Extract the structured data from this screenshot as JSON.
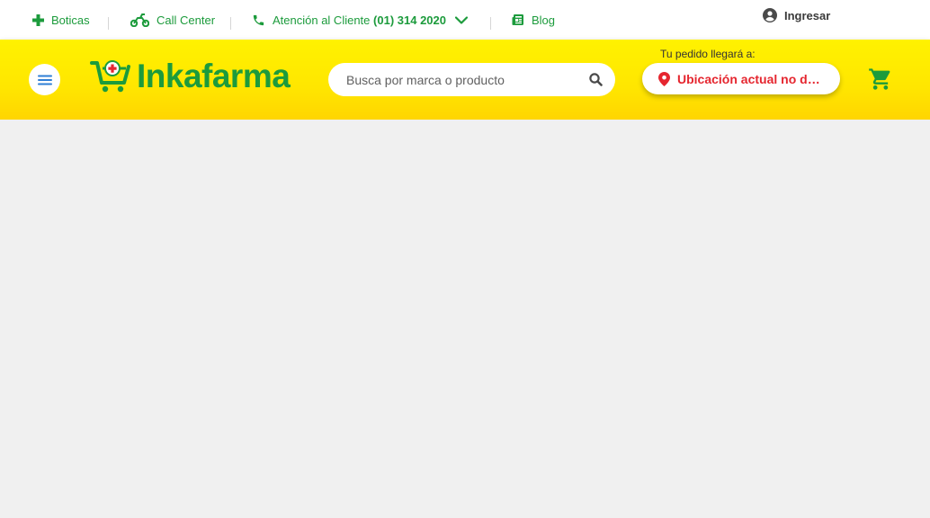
{
  "topbar": {
    "boticas": "Boticas",
    "call_center": "Call Center",
    "atencion_prefix": "Atención al Cliente",
    "atencion_phone": "(01) 314 2020",
    "blog": "Blog",
    "login": "Ingresar"
  },
  "header": {
    "logo_text": "Inkafarma",
    "search_placeholder": "Busca por marca o producto",
    "delivery_label": "Tu pedido llegará a:",
    "location_text": "Ubicación actual no disponible"
  },
  "icons": {
    "cross": "cross-icon",
    "moto": "motorcycle-icon",
    "phone": "phone-icon",
    "chevron": "chevron-down-icon",
    "blog": "newspaper-icon",
    "user": "user-circle-icon",
    "menu": "hamburger-icon",
    "search": "search-icon",
    "pin": "location-pin-icon",
    "cart": "cart-icon"
  },
  "colors": {
    "brand_green": "#1c9b3c",
    "header_yellow": "#ffe600",
    "alert_red": "#e5262f",
    "menu_blue": "#2f7fd6"
  }
}
